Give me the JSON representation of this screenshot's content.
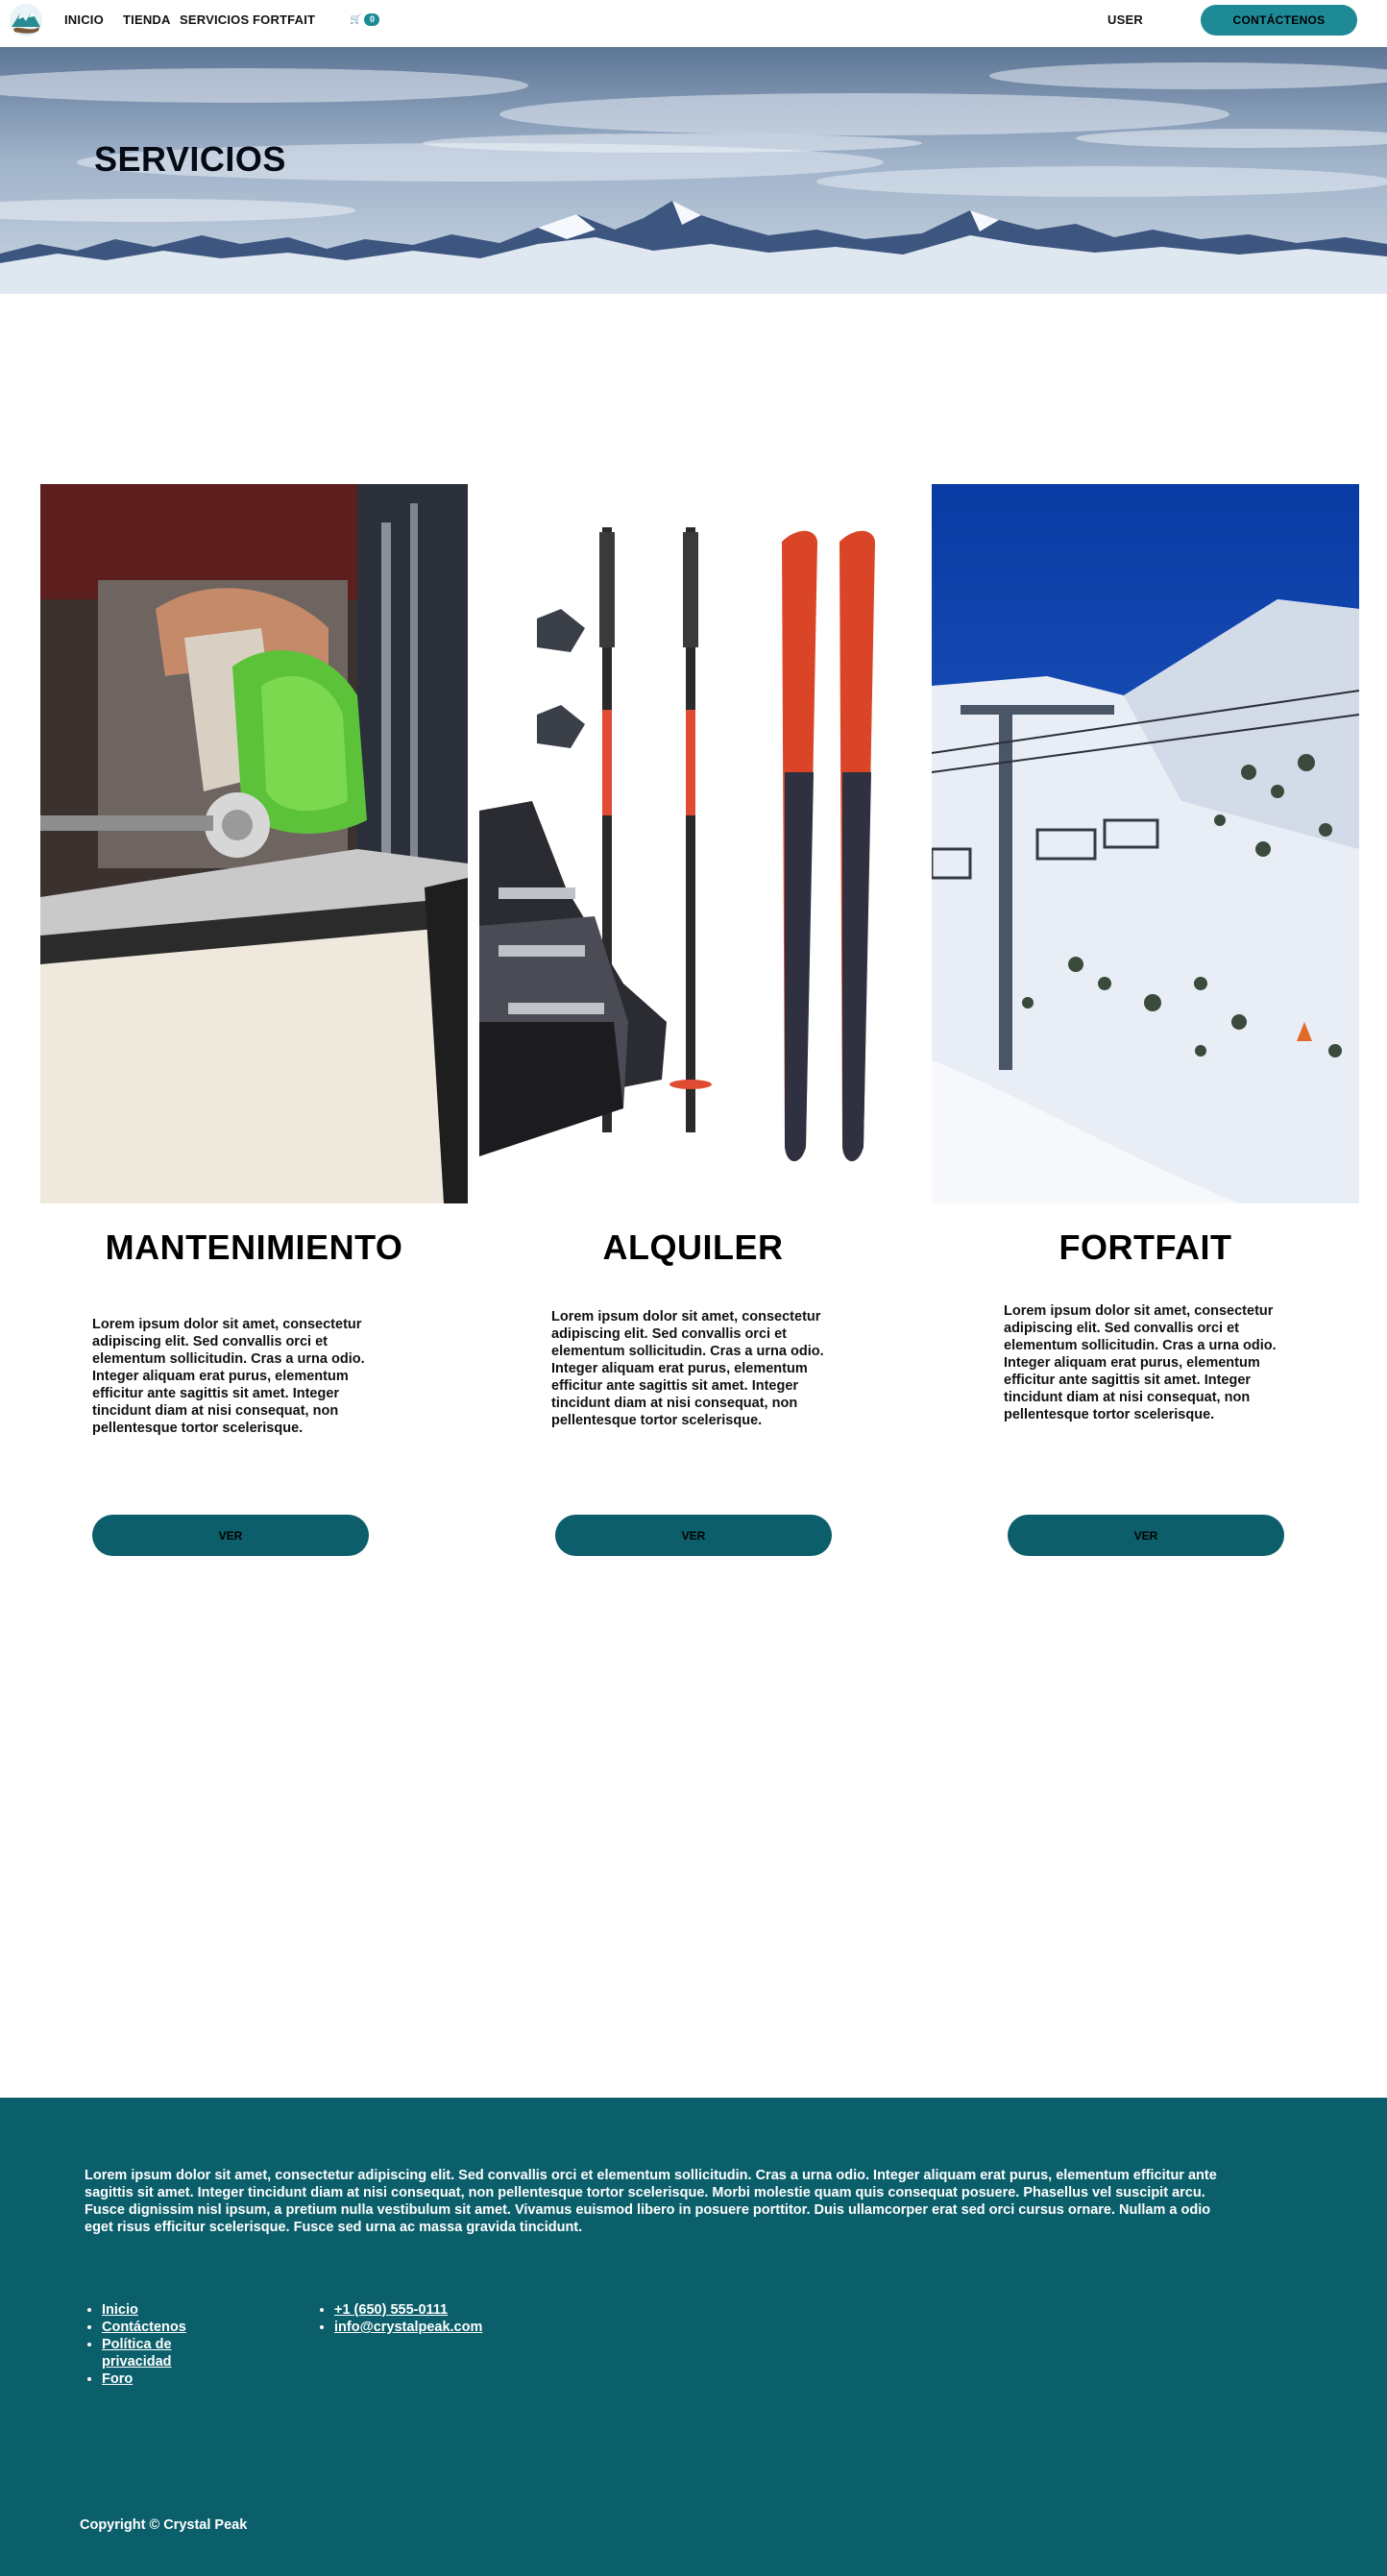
{
  "nav": {
    "logo_icon": "mountain-globe-logo",
    "links": [
      "INICIO",
      "TIENDA",
      "SERVICIOS",
      "FORTFAIT"
    ],
    "cart_count": "0",
    "user_label": "USER",
    "contact_label": "CONTÁCTENOS"
  },
  "hero": {
    "title": "SERVICIOS"
  },
  "services": [
    {
      "title": "MANTENIMIENTO",
      "image": "ski-binding-maintenance-photo",
      "text": "Lorem ipsum dolor sit amet, consectetur adipiscing elit. Sed convallis orci et elementum sollicitudin. Cras a urna odio. Integer aliquam erat purus, elementum efficitur ante sagittis sit amet. Integer tincidunt diam at nisi consequat, non pellentesque tortor scelerisque.",
      "button": "VER"
    },
    {
      "title": "ALQUILER",
      "image": "ski-equipment-rental-photo",
      "text": "Lorem ipsum dolor sit amet, consectetur adipiscing elit. Sed convallis orci et elementum sollicitudin. Cras a urna odio. Integer aliquam erat purus, elementum efficitur ante sagittis sit amet. Integer tincidunt diam at nisi consequat, non pellentesque tortor scelerisque.",
      "button": "VER"
    },
    {
      "title": "FORTFAIT",
      "image": "ski-lift-mountain-photo",
      "text": "Lorem ipsum dolor sit amet, consectetur adipiscing elit. Sed convallis orci et elementum sollicitudin. Cras a urna odio. Integer aliquam erat purus, elementum efficitur ante sagittis sit amet. Integer tincidunt diam at nisi consequat, non pellentesque tortor scelerisque.",
      "button": "VER"
    }
  ],
  "footer": {
    "text": "Lorem ipsum dolor sit amet, consectetur adipiscing elit. Sed convallis orci et elementum sollicitudin. Cras a urna odio. Integer aliquam erat purus, elementum efficitur ante sagittis sit amet. Integer tincidunt diam at nisi consequat, non pellentesque tortor scelerisque. Morbi molestie quam quis consequat posuere. Phasellus vel suscipit arcu. Fusce dignissim nisl ipsum, a pretium nulla vestibulum sit amet. Vivamus euismod libero in posuere porttitor. Duis ullamcorper erat sed orci cursus ornare. Nullam a odio eget risus efficitur scelerisque. Fusce sed urna ac massa gravida tincidunt.",
    "links": [
      "Inicio",
      "Contáctenos",
      "Política de privacidad",
      "Foro"
    ],
    "contacts": [
      "+1 (650) 555-0111",
      "info@crystalpeak.com"
    ],
    "copyright": "Copyright © Crystal Peak"
  },
  "colors": {
    "accent": "#1d8a96",
    "footer_bg": "#0b5f6b",
    "button_bg": "#0b5e6a"
  }
}
